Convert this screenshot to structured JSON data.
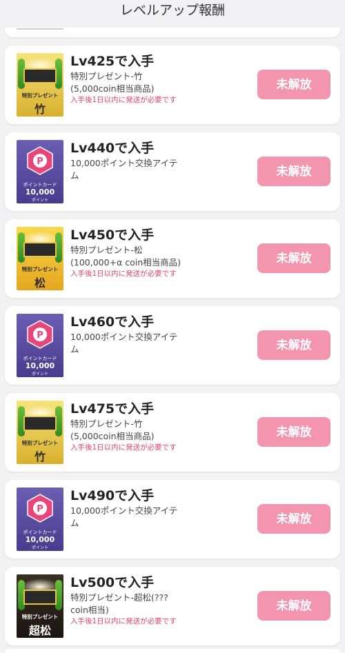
{
  "header": {
    "title": "レベルアップ報酬"
  },
  "rewards": [
    {
      "title": "Lv425で入手",
      "desc": "特別プレゼント-竹\n(5,000coin相当商品)",
      "note": "入手後1日以内に発送が必要です",
      "button": "未解放",
      "thumb": "take",
      "thumb_label": "特別プレゼント",
      "thumb_grade": "竹"
    },
    {
      "title": "Lv440で入手",
      "desc": "10,000ポイント交換アイテ\nム",
      "note": "",
      "button": "未解放",
      "thumb": "point",
      "thumb_label": "ポイントカード",
      "thumb_value": "10,000",
      "thumb_unit": "ポイント"
    },
    {
      "title": "Lv450で入手",
      "desc": "特別プレゼント-松\n(100,000+α coin相当商品)",
      "note": "入手後1日以内に発送が必要です",
      "button": "未解放",
      "thumb": "matsu",
      "thumb_label": "特別プレゼント",
      "thumb_grade": "松"
    },
    {
      "title": "Lv460で入手",
      "desc": "10,000ポイント交換アイテ\nム",
      "note": "",
      "button": "未解放",
      "thumb": "point",
      "thumb_label": "ポイントカード",
      "thumb_value": "10,000",
      "thumb_unit": "ポイント"
    },
    {
      "title": "Lv475で入手",
      "desc": "特別プレゼント-竹\n(5,000coin相当商品)",
      "note": "入手後1日以内に発送が必要です",
      "button": "未解放",
      "thumb": "take",
      "thumb_label": "特別プレゼント",
      "thumb_grade": "竹"
    },
    {
      "title": "Lv490で入手",
      "desc": "10,000ポイント交換アイテ\nム",
      "note": "",
      "button": "未解放",
      "thumb": "point",
      "thumb_label": "ポイントカード",
      "thumb_value": "10,000",
      "thumb_unit": "ポイント"
    },
    {
      "title": "Lv500で入手",
      "desc": "特別プレゼント-超松(???\ncoin相当)",
      "note": "入手後1日以内に発送が必要です",
      "button": "未解放",
      "thumb": "chou",
      "thumb_label": "特別プレゼント",
      "thumb_grade": "超松"
    }
  ],
  "colors": {
    "button": "#f495b0",
    "note": "#e0456e",
    "point_card": "#5a4ea3"
  },
  "icons": {
    "point_card": "p-hexagon-icon",
    "gift": "gift-box-icon"
  }
}
